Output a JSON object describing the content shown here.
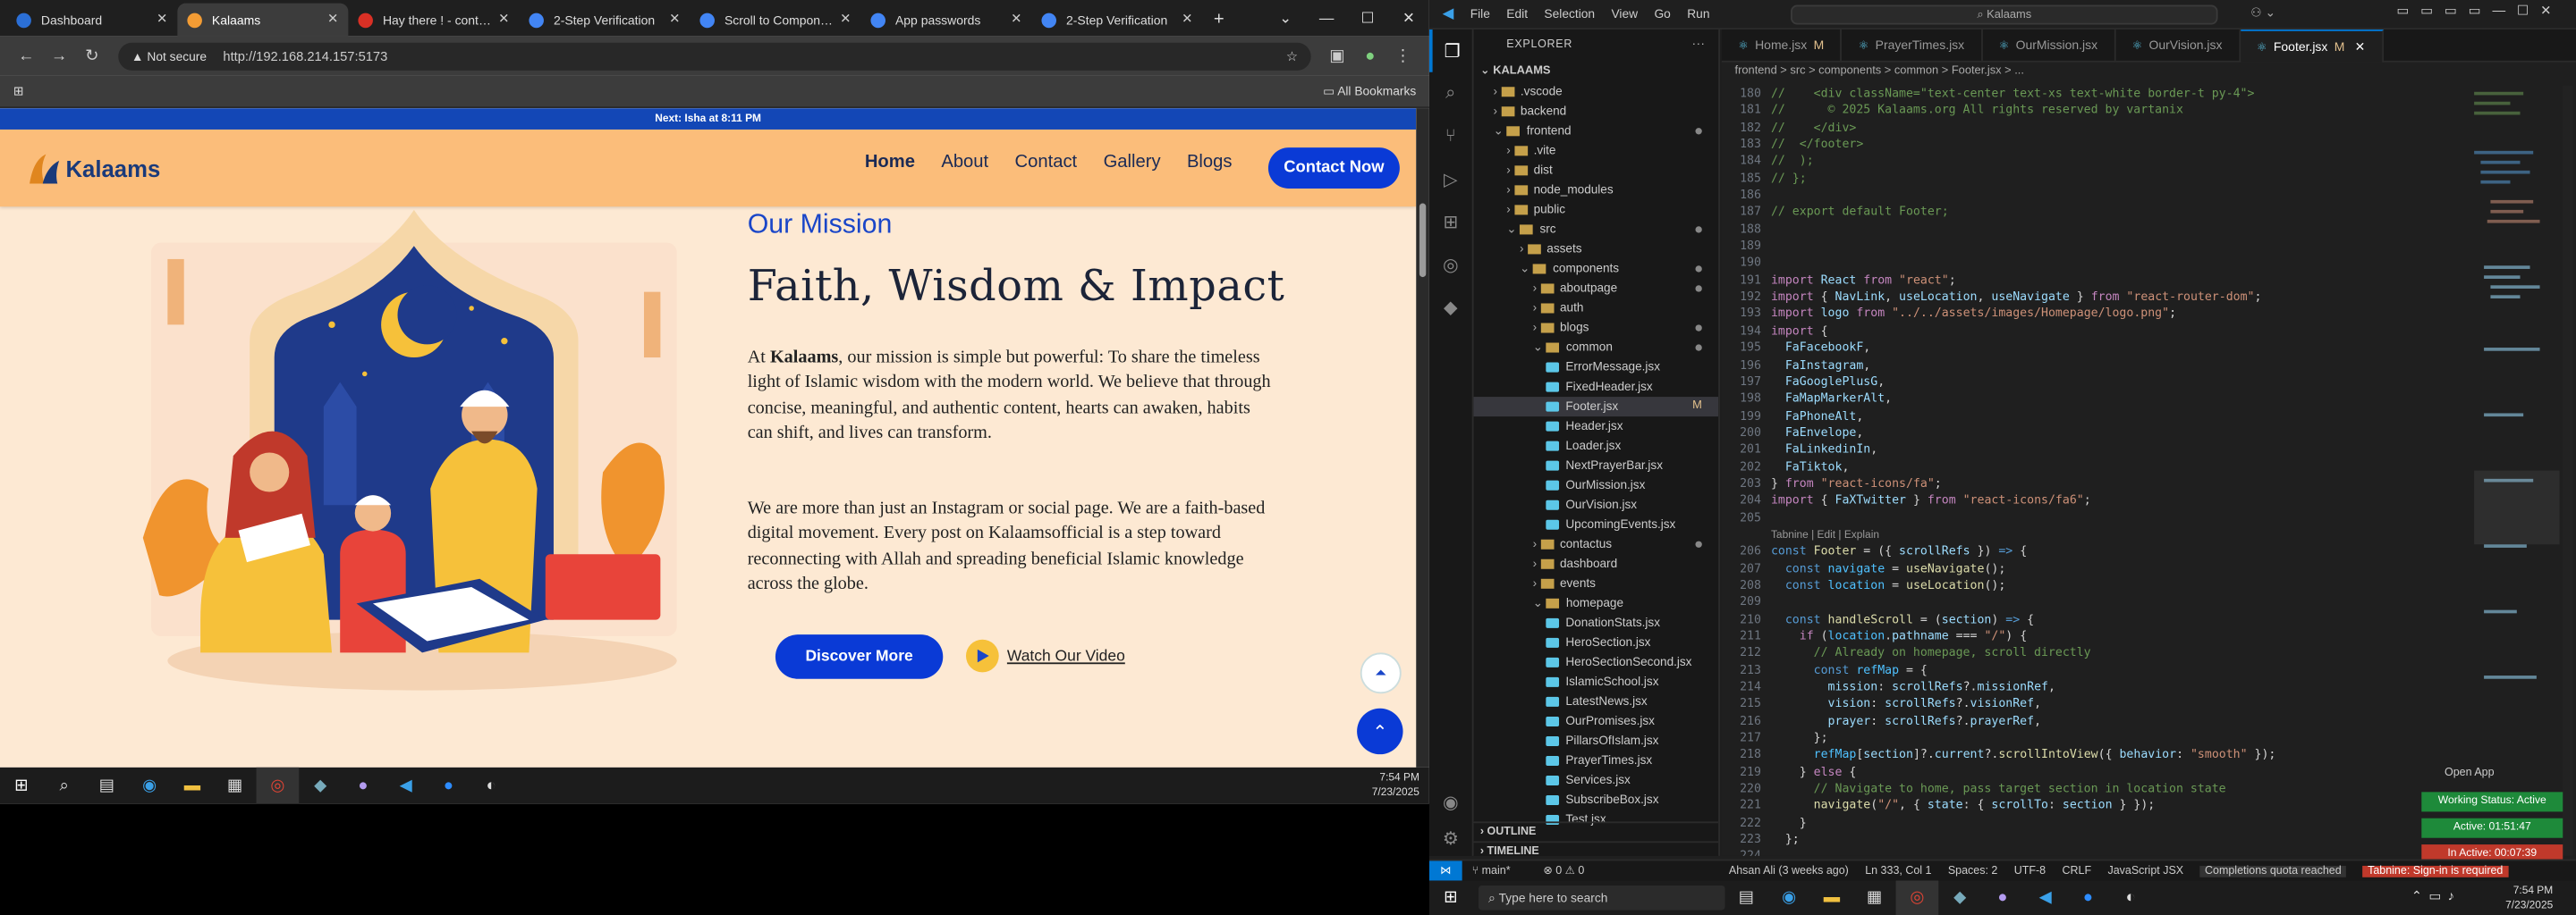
{
  "browser": {
    "tabs": [
      {
        "label": "Dashboard",
        "color": "#2b6fd6"
      },
      {
        "label": "Kalaams",
        "color": "#f39c34"
      },
      {
        "label": "Hay there ! - contanis",
        "color": "#d93025"
      },
      {
        "label": "2-Step Verification",
        "color": "#4285f4"
      },
      {
        "label": "Scroll to Components",
        "color": "#4285f4"
      },
      {
        "label": "App passwords",
        "color": "#4285f4"
      },
      {
        "label": "2-Step Verification",
        "color": "#4285f4"
      }
    ],
    "new_tab": "+",
    "security": "Not secure",
    "url": "http://192.168.214.157:5173",
    "bookmarks": "All Bookmarks"
  },
  "site": {
    "prayer_bar": "Next: Isha at 8:11 PM",
    "logo_text": "Kalaams",
    "menu": [
      {
        "label": "Home",
        "current": true
      },
      {
        "label": "About",
        "current": false
      },
      {
        "label": "Contact",
        "current": false
      },
      {
        "label": "Gallery",
        "current": false
      },
      {
        "label": "Blogs",
        "current": false
      }
    ],
    "contact_btn": "Contact Now",
    "mission_title": "Our Mission",
    "mission_heading": "Faith, Wisdom & Impact",
    "p1_prefix": "At ",
    "p1_brand": "Kalaams",
    "p1_rest": ", our mission is simple but powerful: To share the timeless light of Islamic wisdom with the modern world. We believe that through concise, meaningful, and authentic content, hearts can awaken, habits can shift, and lives can transform.",
    "p2": "We are more than just an Instagram or social page. We are a faith-based digital movement. Every post on Kalaamsofficial is a step toward reconnecting with Allah and spreading beneficial Islamic knowledge across the globe.",
    "discover_btn": "Discover More",
    "watch_label": "Watch Our Video"
  },
  "vm_clock": {
    "time": "7:54 PM",
    "date": "7/23/2025"
  },
  "vscode": {
    "menu": [
      "File",
      "Edit",
      "Selection",
      "View",
      "Go",
      "Run"
    ],
    "search": "Kalaams",
    "explorer_title": "EXPLORER",
    "root": "KALAAMS",
    "tree": [
      {
        "label": ".vscode",
        "depth": 1,
        "kind": "folder",
        "open": false
      },
      {
        "label": "backend",
        "depth": 1,
        "kind": "folder",
        "open": false
      },
      {
        "label": "frontend",
        "depth": 1,
        "kind": "folder",
        "open": true,
        "dot": true
      },
      {
        "label": ".vite",
        "depth": 2,
        "kind": "folder",
        "open": false
      },
      {
        "label": "dist",
        "depth": 2,
        "kind": "folder",
        "open": false
      },
      {
        "label": "node_modules",
        "depth": 2,
        "kind": "folder",
        "open": false
      },
      {
        "label": "public",
        "depth": 2,
        "kind": "folder",
        "open": false
      },
      {
        "label": "src",
        "depth": 2,
        "kind": "folder",
        "open": true,
        "dot": true
      },
      {
        "label": "assets",
        "depth": 3,
        "kind": "folder",
        "open": false
      },
      {
        "label": "components",
        "depth": 3,
        "kind": "folder",
        "open": true,
        "dot": true
      },
      {
        "label": "aboutpage",
        "depth": 4,
        "kind": "folder",
        "open": false,
        "dot": true
      },
      {
        "label": "auth",
        "depth": 4,
        "kind": "folder",
        "open": false
      },
      {
        "label": "blogs",
        "depth": 4,
        "kind": "folder",
        "open": false,
        "dot": true
      },
      {
        "label": "common",
        "depth": 4,
        "kind": "folder",
        "open": true,
        "dot": true
      },
      {
        "label": "ErrorMessage.jsx",
        "depth": 5,
        "kind": "file"
      },
      {
        "label": "FixedHeader.jsx",
        "depth": 5,
        "kind": "file"
      },
      {
        "label": "Footer.jsx",
        "depth": 5,
        "kind": "file",
        "sel": true,
        "mod": "M"
      },
      {
        "label": "Header.jsx",
        "depth": 5,
        "kind": "file"
      },
      {
        "label": "Loader.jsx",
        "depth": 5,
        "kind": "file"
      },
      {
        "label": "NextPrayerBar.jsx",
        "depth": 5,
        "kind": "file"
      },
      {
        "label": "OurMission.jsx",
        "depth": 5,
        "kind": "file"
      },
      {
        "label": "OurVision.jsx",
        "depth": 5,
        "kind": "file"
      },
      {
        "label": "UpcomingEvents.jsx",
        "depth": 5,
        "kind": "file"
      },
      {
        "label": "contactus",
        "depth": 4,
        "kind": "folder",
        "open": false,
        "dot": true
      },
      {
        "label": "dashboard",
        "depth": 4,
        "kind": "folder",
        "open": false
      },
      {
        "label": "events",
        "depth": 4,
        "kind": "folder",
        "open": false
      },
      {
        "label": "homepage",
        "depth": 4,
        "kind": "folder",
        "open": true
      },
      {
        "label": "DonationStats.jsx",
        "depth": 5,
        "kind": "file"
      },
      {
        "label": "HeroSection.jsx",
        "depth": 5,
        "kind": "file"
      },
      {
        "label": "HeroSectionSecond.jsx",
        "depth": 5,
        "kind": "file"
      },
      {
        "label": "IslamicSchool.jsx",
        "depth": 5,
        "kind": "file"
      },
      {
        "label": "LatestNews.jsx",
        "depth": 5,
        "kind": "file"
      },
      {
        "label": "OurPromises.jsx",
        "depth": 5,
        "kind": "file"
      },
      {
        "label": "PillarsOfIslam.jsx",
        "depth": 5,
        "kind": "file"
      },
      {
        "label": "PrayerTimes.jsx",
        "depth": 5,
        "kind": "file"
      },
      {
        "label": "Services.jsx",
        "depth": 5,
        "kind": "file"
      },
      {
        "label": "SubscribeBox.jsx",
        "depth": 5,
        "kind": "file"
      },
      {
        "label": "Test.jsx",
        "depth": 5,
        "kind": "file"
      }
    ],
    "outline": "OUTLINE",
    "timeline": "TIMELINE",
    "tabs": [
      {
        "label": "Home.jsx",
        "mod": "M",
        "active": false
      },
      {
        "label": "PrayerTimes.jsx",
        "mod": "",
        "active": false
      },
      {
        "label": "OurMission.jsx",
        "mod": "",
        "active": false
      },
      {
        "label": "OurVision.jsx",
        "mod": "",
        "active": false
      },
      {
        "label": "Footer.jsx",
        "mod": "M",
        "active": true
      }
    ],
    "breadcrumb": "frontend > src > components > common > Footer.jsx > ...",
    "codelens": "Tabnine | Edit | Explain",
    "code": [
      {
        "n": "180",
        "s": [
          [
            "cm",
            "//    <div className=\"text-center text-xs text-white border-t py-4\">"
          ]
        ]
      },
      {
        "n": "181",
        "s": [
          [
            "cm",
            "//      © 2025 Kalaams.org All rights reserved by vartanix"
          ]
        ]
      },
      {
        "n": "182",
        "s": [
          [
            "cm",
            "//    </div>"
          ]
        ]
      },
      {
        "n": "183",
        "s": [
          [
            "cm",
            "//  </footer>"
          ]
        ]
      },
      {
        "n": "184",
        "s": [
          [
            "cm",
            "//  );"
          ]
        ]
      },
      {
        "n": "185",
        "s": [
          [
            "cm",
            "// };"
          ]
        ]
      },
      {
        "n": "186",
        "s": []
      },
      {
        "n": "187",
        "s": [
          [
            "cm",
            "// export default Footer;"
          ]
        ]
      },
      {
        "n": "188",
        "s": []
      },
      {
        "n": "189",
        "s": []
      },
      {
        "n": "190",
        "s": []
      },
      {
        "n": "191",
        "s": [
          [
            "kw",
            "import "
          ],
          [
            "vr",
            "React "
          ],
          [
            "kw",
            "from "
          ],
          [
            "st",
            "\"react\""
          ],
          [
            "pl",
            ";"
          ]
        ]
      },
      {
        "n": "192",
        "s": [
          [
            "kw",
            "import "
          ],
          [
            "pl",
            "{ "
          ],
          [
            "vr",
            "NavLink"
          ],
          [
            "pl",
            ", "
          ],
          [
            "vr",
            "useLocation"
          ],
          [
            "pl",
            ", "
          ],
          [
            "vr",
            "useNavigate "
          ],
          [
            "pl",
            "} "
          ],
          [
            "kw",
            "from "
          ],
          [
            "st",
            "\"react-router-dom\""
          ],
          [
            "pl",
            ";"
          ]
        ]
      },
      {
        "n": "193",
        "s": [
          [
            "kw",
            "import "
          ],
          [
            "vr",
            "logo "
          ],
          [
            "kw",
            "from "
          ],
          [
            "st",
            "\"../../assets/images/Homepage/logo.png\""
          ],
          [
            "pl",
            ";"
          ]
        ]
      },
      {
        "n": "194",
        "s": [
          [
            "kw",
            "import "
          ],
          [
            "pl",
            "{"
          ]
        ]
      },
      {
        "n": "195",
        "s": [
          [
            "vr",
            "  FaFacebookF"
          ],
          [
            "pl",
            ","
          ]
        ]
      },
      {
        "n": "196",
        "s": [
          [
            "vr",
            "  FaInstagram"
          ],
          [
            "pl",
            ","
          ]
        ]
      },
      {
        "n": "197",
        "s": [
          [
            "vr",
            "  FaGooglePlusG"
          ],
          [
            "pl",
            ","
          ]
        ]
      },
      {
        "n": "198",
        "s": [
          [
            "vr",
            "  FaMapMarkerAlt"
          ],
          [
            "pl",
            ","
          ]
        ]
      },
      {
        "n": "199",
        "s": [
          [
            "vr",
            "  FaPhoneAlt"
          ],
          [
            "pl",
            ","
          ]
        ]
      },
      {
        "n": "200",
        "s": [
          [
            "vr",
            "  FaEnvelope"
          ],
          [
            "pl",
            ","
          ]
        ]
      },
      {
        "n": "201",
        "s": [
          [
            "vr",
            "  FaLinkedinIn"
          ],
          [
            "pl",
            ","
          ]
        ]
      },
      {
        "n": "202",
        "s": [
          [
            "vr",
            "  FaTiktok"
          ],
          [
            "pl",
            ","
          ]
        ]
      },
      {
        "n": "203",
        "s": [
          [
            "pl",
            "} "
          ],
          [
            "kw",
            "from "
          ],
          [
            "st",
            "\"react-icons/fa\""
          ],
          [
            "pl",
            ";"
          ]
        ]
      },
      {
        "n": "204",
        "s": [
          [
            "kw",
            "import "
          ],
          [
            "pl",
            "{ "
          ],
          [
            "vr",
            "FaXTwitter "
          ],
          [
            "pl",
            "} "
          ],
          [
            "kw",
            "from "
          ],
          [
            "st",
            "\"react-icons/fa6\""
          ],
          [
            "pl",
            ";"
          ]
        ]
      },
      {
        "n": "205",
        "s": []
      },
      {
        "n": "",
        "lens": true,
        "s": []
      },
      {
        "n": "206",
        "s": [
          [
            "kb",
            "const "
          ],
          [
            "fn",
            "Footer "
          ],
          [
            "pl",
            "= ({ "
          ],
          [
            "vr",
            "scrollRefs "
          ],
          [
            "pl",
            "}) "
          ],
          [
            "kb",
            "=> "
          ],
          [
            "pl",
            "{"
          ]
        ]
      },
      {
        "n": "207",
        "s": [
          [
            "kb",
            "  const "
          ],
          [
            "cn",
            "navigate "
          ],
          [
            "pl",
            "= "
          ],
          [
            "fn",
            "useNavigate"
          ],
          [
            "pl",
            "();"
          ]
        ]
      },
      {
        "n": "208",
        "s": [
          [
            "kb",
            "  const "
          ],
          [
            "cn",
            "location "
          ],
          [
            "pl",
            "= "
          ],
          [
            "fn",
            "useLocation"
          ],
          [
            "pl",
            "();"
          ]
        ]
      },
      {
        "n": "209",
        "s": []
      },
      {
        "n": "210",
        "s": [
          [
            "kb",
            "  const "
          ],
          [
            "fn",
            "handleScroll "
          ],
          [
            "pl",
            "= ("
          ],
          [
            "vr",
            "section"
          ],
          [
            "pl",
            ") "
          ],
          [
            "kb",
            "=> "
          ],
          [
            "pl",
            "{"
          ]
        ]
      },
      {
        "n": "211",
        "s": [
          [
            "kw",
            "    if "
          ],
          [
            "pl",
            "("
          ],
          [
            "cn",
            "location"
          ],
          [
            "pl",
            "."
          ],
          [
            "vr",
            "pathname "
          ],
          [
            "pl",
            "=== "
          ],
          [
            "st",
            "\"/\""
          ],
          [
            "pl",
            ") {"
          ]
        ]
      },
      {
        "n": "212",
        "s": [
          [
            "cm",
            "      // Already on homepage, scroll directly"
          ]
        ]
      },
      {
        "n": "213",
        "s": [
          [
            "kb",
            "      const "
          ],
          [
            "cn",
            "refMap "
          ],
          [
            "pl",
            "= {"
          ]
        ]
      },
      {
        "n": "214",
        "s": [
          [
            "vr",
            "        mission"
          ],
          [
            "pl",
            ": "
          ],
          [
            "vr",
            "scrollRefs"
          ],
          [
            "pl",
            "?."
          ],
          [
            "vr",
            "missionRef"
          ],
          [
            "pl",
            ","
          ]
        ]
      },
      {
        "n": "215",
        "s": [
          [
            "vr",
            "        vision"
          ],
          [
            "pl",
            ": "
          ],
          [
            "vr",
            "scrollRefs"
          ],
          [
            "pl",
            "?."
          ],
          [
            "vr",
            "visionRef"
          ],
          [
            "pl",
            ","
          ]
        ]
      },
      {
        "n": "216",
        "s": [
          [
            "vr",
            "        prayer"
          ],
          [
            "pl",
            ": "
          ],
          [
            "vr",
            "scrollRefs"
          ],
          [
            "pl",
            "?."
          ],
          [
            "vr",
            "prayerRef"
          ],
          [
            "pl",
            ","
          ]
        ]
      },
      {
        "n": "217",
        "s": [
          [
            "pl",
            "      };"
          ]
        ]
      },
      {
        "n": "218",
        "s": [
          [
            "cn",
            "      refMap"
          ],
          [
            "pl",
            "["
          ],
          [
            "vr",
            "section"
          ],
          [
            "pl",
            "]?."
          ],
          [
            "vr",
            "current"
          ],
          [
            "pl",
            "?."
          ],
          [
            "fn",
            "scrollIntoView"
          ],
          [
            "pl",
            "({ "
          ],
          [
            "vr",
            "behavior"
          ],
          [
            "pl",
            ": "
          ],
          [
            "st",
            "\"smooth\" "
          ],
          [
            "pl",
            "});"
          ]
        ]
      },
      {
        "n": "219",
        "s": [
          [
            "pl",
            "    } "
          ],
          [
            "kw",
            "else "
          ],
          [
            "pl",
            "{"
          ]
        ]
      },
      {
        "n": "220",
        "s": [
          [
            "cm",
            "      // Navigate to home, pass target section in location state"
          ]
        ]
      },
      {
        "n": "221",
        "s": [
          [
            "fn",
            "      navigate"
          ],
          [
            "pl",
            "("
          ],
          [
            "st",
            "\"/\""
          ],
          [
            "pl",
            ", { "
          ],
          [
            "vr",
            "state"
          ],
          [
            "pl",
            ": { "
          ],
          [
            "vr",
            "scrollTo"
          ],
          [
            "pl",
            ": "
          ],
          [
            "vr",
            "section "
          ],
          [
            "pl",
            "} });"
          ]
        ]
      },
      {
        "n": "222",
        "s": [
          [
            "pl",
            "    }"
          ]
        ]
      },
      {
        "n": "223",
        "s": [
          [
            "pl",
            "  };"
          ]
        ]
      },
      {
        "n": "224",
        "s": []
      }
    ],
    "open_app": "Open App",
    "status": {
      "branch": "main*",
      "errors": "⊗ 0 ⚠ 0",
      "blame": "Ahsan Ali (3 weeks ago)",
      "pos": "Ln 333, Col 1",
      "spaces": "Spaces: 2",
      "enc": "UTF-8",
      "eol": "CRLF",
      "lang": "JavaScript JSX",
      "quota": "Completions quota reached",
      "tabnine": "Tabnine: Sign-in is required"
    },
    "badges": {
      "working": "Working Status: Active",
      "active": "Active: 01:51:47",
      "inactive": "In Active: 00:07:39"
    }
  },
  "host": {
    "search_placeholder": "Type here to search",
    "time": "7:54 PM",
    "date": "7/23/2025"
  },
  "colors": {
    "brand_blue": "#0a3ad6",
    "nav_orange": "#fbbd7a",
    "page_bg": "#fde9d3",
    "vscode_accent": "#0078d4"
  }
}
